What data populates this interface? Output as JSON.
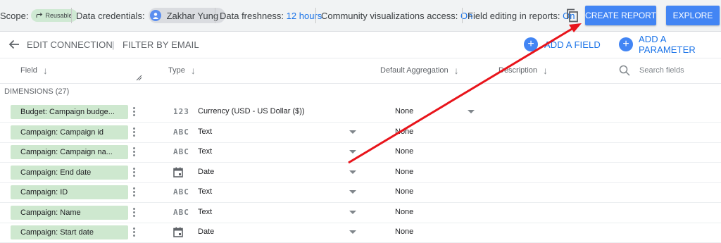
{
  "topbar": {
    "scope_label": "Scope:",
    "scope_badge": "Reusable",
    "credentials_label": "Data credentials:",
    "credentials_user": "Zakhar Yung",
    "freshness_label": "Data freshness:",
    "freshness_value": "12 hours",
    "community_label": "Community visualizations access:",
    "community_value": "On",
    "field_editing_label": "Field editing in reports:",
    "field_editing_value": "On",
    "create_report": "CREATE REPORT",
    "explore": "EXPLORE"
  },
  "toolbar": {
    "edit_connection": "EDIT CONNECTION",
    "separator": "|",
    "filter_by_email": "FILTER BY EMAIL",
    "add_field": "ADD A FIELD",
    "add_parameter": "ADD A PARAMETER"
  },
  "columns": {
    "field": "Field",
    "type": "Type",
    "default_aggregation": "Default Aggregation",
    "description": "Description",
    "search_placeholder": "Search fields"
  },
  "dimensions": {
    "label": "DIMENSIONS (27)",
    "rows": [
      {
        "field": "Budget: Campaign budge...",
        "type_icon": "123",
        "type": "Currency (USD - US Dollar ($))",
        "aggregation": "None"
      },
      {
        "field": "Campaign: Campaign id",
        "type_icon": "ABC",
        "type": "Text",
        "aggregation": "None"
      },
      {
        "field": "Campaign: Campaign na...",
        "type_icon": "ABC",
        "type": "Text",
        "aggregation": "None"
      },
      {
        "field": "Campaign: End date",
        "type_icon": "calendar-icon",
        "type": "Date",
        "aggregation": "None"
      },
      {
        "field": "Campaign: ID",
        "type_icon": "ABC",
        "type": "Text",
        "aggregation": "None"
      },
      {
        "field": "Campaign: Name",
        "type_icon": "ABC",
        "type": "Text",
        "aggregation": "None"
      },
      {
        "field": "Campaign: Start date",
        "type_icon": "calendar-icon",
        "type": "Date",
        "aggregation": "None"
      }
    ]
  },
  "colors": {
    "accent": "#4285f4",
    "field_pill": "#cee8cf",
    "annotation_arrow": "#e8141b"
  }
}
